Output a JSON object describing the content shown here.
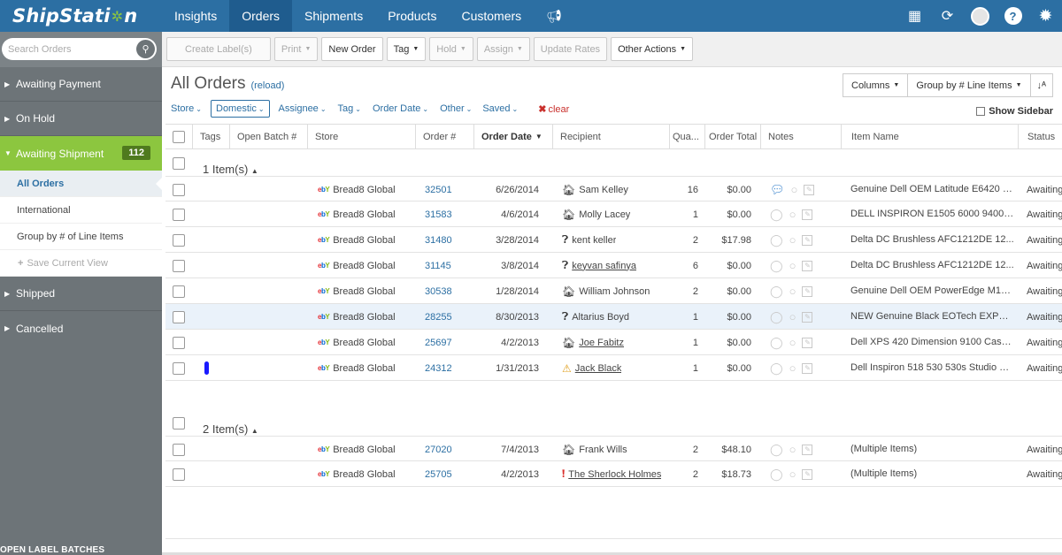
{
  "app": {
    "logo_left": "ShipStati",
    "logo_right": "n"
  },
  "nav": {
    "items": [
      {
        "label": "Insights",
        "active": false
      },
      {
        "label": "Orders",
        "active": true
      },
      {
        "label": "Shipments",
        "active": false
      },
      {
        "label": "Products",
        "active": false
      },
      {
        "label": "Customers",
        "active": false
      }
    ]
  },
  "sidebar": {
    "search_placeholder": "Search Orders",
    "sections": [
      {
        "label": "Awaiting Payment"
      },
      {
        "label": "On Hold"
      }
    ],
    "awaiting_shipment": {
      "label": "Awaiting Shipment",
      "count": "112"
    },
    "sub_items": [
      {
        "label": "All Orders"
      },
      {
        "label": "International"
      },
      {
        "label": "Group by # of Line Items"
      }
    ],
    "save_view": "Save Current View",
    "lower_sections": [
      {
        "label": "Shipped"
      },
      {
        "label": "Cancelled"
      }
    ],
    "open_label_batches": "OPEN LABEL BATCHES"
  },
  "toolbar": {
    "create_labels": "Create Label(s)",
    "print": "Print",
    "new_order": "New Order",
    "tag": "Tag",
    "hold": "Hold",
    "assign": "Assign",
    "update_rates": "Update Rates",
    "other_actions": "Other Actions"
  },
  "main": {
    "title": "All Orders",
    "reload": "(reload)",
    "columns_btn": "Columns",
    "group_btn": "Group by # Line Items",
    "show_sidebar": "Show Sidebar",
    "filters": [
      "Store",
      "Domestic",
      "Assignee",
      "Tag",
      "Order Date",
      "Other",
      "Saved"
    ],
    "clear": "clear"
  },
  "table": {
    "headers": {
      "tags": "Tags",
      "batch": "Open Batch #",
      "store": "Store",
      "order": "Order #",
      "date": "Order Date",
      "recipient": "Recipient",
      "qty": "Qua...",
      "total": "Order Total",
      "notes": "Notes",
      "item": "Item Name",
      "status": "Status"
    },
    "groups": [
      {
        "label": "1 Item(s)",
        "rows": [
          {
            "store": "Bread8 Global",
            "order": "32501",
            "date": "6/26/2014",
            "recipient": "Sam Kelley",
            "ricon": "home",
            "qty": "16",
            "total": "$0.00",
            "note": true,
            "item": "Genuine Dell OEM Latitude E6420 Pr...",
            "status": "Awaiting",
            "tag": false
          },
          {
            "store": "Bread8 Global",
            "order": "31583",
            "date": "4/6/2014",
            "recipient": "Molly Lacey",
            "ricon": "home",
            "qty": "1",
            "total": "$0.00",
            "note": false,
            "item": "DELL INSPIRON E1505 6000 9400 ...",
            "status": "Awaiting",
            "tag": false
          },
          {
            "store": "Bread8 Global",
            "order": "31480",
            "date": "3/28/2014",
            "recipient": "kent keller",
            "ricon": "q",
            "qty": "2",
            "total": "$17.98",
            "note": false,
            "item": "Delta DC Brushless AFC1212DE 12...",
            "status": "Awaiting",
            "tag": false
          },
          {
            "store": "Bread8 Global",
            "order": "31145",
            "date": "3/8/2014",
            "recipient": "keyvan safinya",
            "ricon": "q",
            "qty": "6",
            "total": "$0.00",
            "note": false,
            "item": "Delta DC Brushless AFC1212DE 12...",
            "status": "Awaiting",
            "tag": false,
            "link": true
          },
          {
            "store": "Bread8 Global",
            "order": "30538",
            "date": "1/28/2014",
            "recipient": "William Johnson",
            "ricon": "home",
            "qty": "2",
            "total": "$0.00",
            "note": false,
            "item": "Genuine Dell OEM PowerEdge M100...",
            "status": "Awaiting",
            "tag": false
          },
          {
            "store": "Bread8 Global",
            "order": "28255",
            "date": "8/30/2013",
            "recipient": "Altarius Boyd",
            "ricon": "q",
            "qty": "1",
            "total": "$0.00",
            "note": false,
            "item": "NEW Genuine Black EOTech EXPS3-...",
            "status": "Awaiting",
            "tag": false,
            "hl": true
          },
          {
            "store": "Bread8 Global",
            "order": "25697",
            "date": "4/2/2013",
            "recipient": "Joe Fabitz",
            "ricon": "home",
            "qty": "1",
            "total": "$0.00",
            "note": false,
            "item": "Dell XPS 420 Dimension 9100 Case ...",
            "status": "Awaiting",
            "tag": false,
            "link": true
          },
          {
            "store": "Bread8 Global",
            "order": "24312",
            "date": "1/31/2013",
            "recipient": "Jack Black",
            "ricon": "warn",
            "qty": "1",
            "total": "$0.00",
            "note": false,
            "item": "Dell Inspiron 518 530 530s Studio 54...",
            "status": "Awaiting",
            "tag": true,
            "link": true
          }
        ]
      },
      {
        "label": "2 Item(s)",
        "rows": [
          {
            "store": "Bread8 Global",
            "order": "27020",
            "date": "7/4/2013",
            "recipient": "Frank Wills",
            "ricon": "home",
            "qty": "2",
            "total": "$48.10",
            "note": false,
            "item": "(Multiple Items)",
            "status": "Awaiting",
            "tag": false
          },
          {
            "store": "Bread8 Global",
            "order": "25705",
            "date": "4/2/2013",
            "recipient": "The Sherlock Holmes",
            "ricon": "err",
            "qty": "2",
            "total": "$18.73",
            "note": false,
            "item": "(Multiple Items)",
            "status": "Awaiting",
            "tag": false,
            "link": true
          }
        ]
      }
    ]
  }
}
